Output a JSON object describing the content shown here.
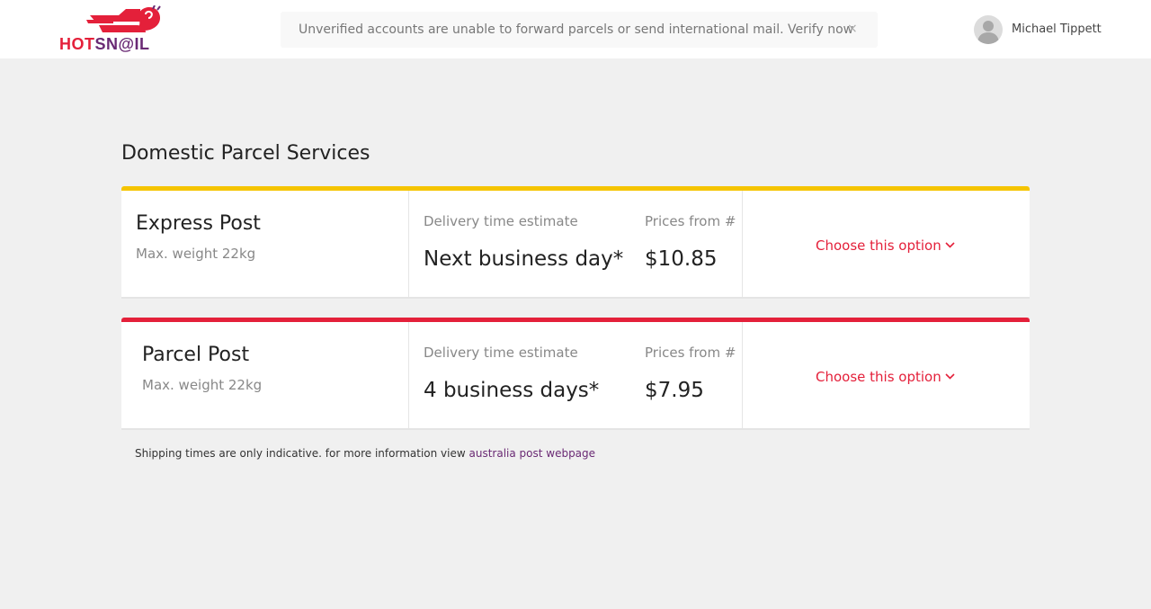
{
  "header": {
    "logo": {
      "part1": "HOT",
      "part2": "SN@IL",
      "colors": {
        "red": "#e4203a",
        "purple": "#6a2a74"
      }
    },
    "notice": {
      "text": "Unverified accounts are unable to forward parcels or send international mail. Verify now",
      "close": "×"
    },
    "user": {
      "name": "Michael Tippett",
      "avatar_icon": "user-avatar-icon"
    }
  },
  "main": {
    "title": "Domestic Parcel Services",
    "services": [
      {
        "name": "Express Post",
        "weight": "Max. weight 22kg",
        "time_label": "Delivery time estimate",
        "time_value": "Next business day*",
        "price_label": "Prices from #",
        "price_value": "$10.85",
        "cta": "Choose this option",
        "accent": "#f5c400"
      },
      {
        "name": "Parcel Post",
        "weight": "Max. weight 22kg",
        "time_label": "Delivery time estimate",
        "time_value": "4 business days*",
        "price_label": "Prices from #",
        "price_value": "$7.95",
        "cta": "Choose this option",
        "accent": "#e4203a"
      }
    ],
    "footnote": {
      "text": "Shipping times are only indicative. for more information view ",
      "link": "australia post webpage"
    }
  }
}
